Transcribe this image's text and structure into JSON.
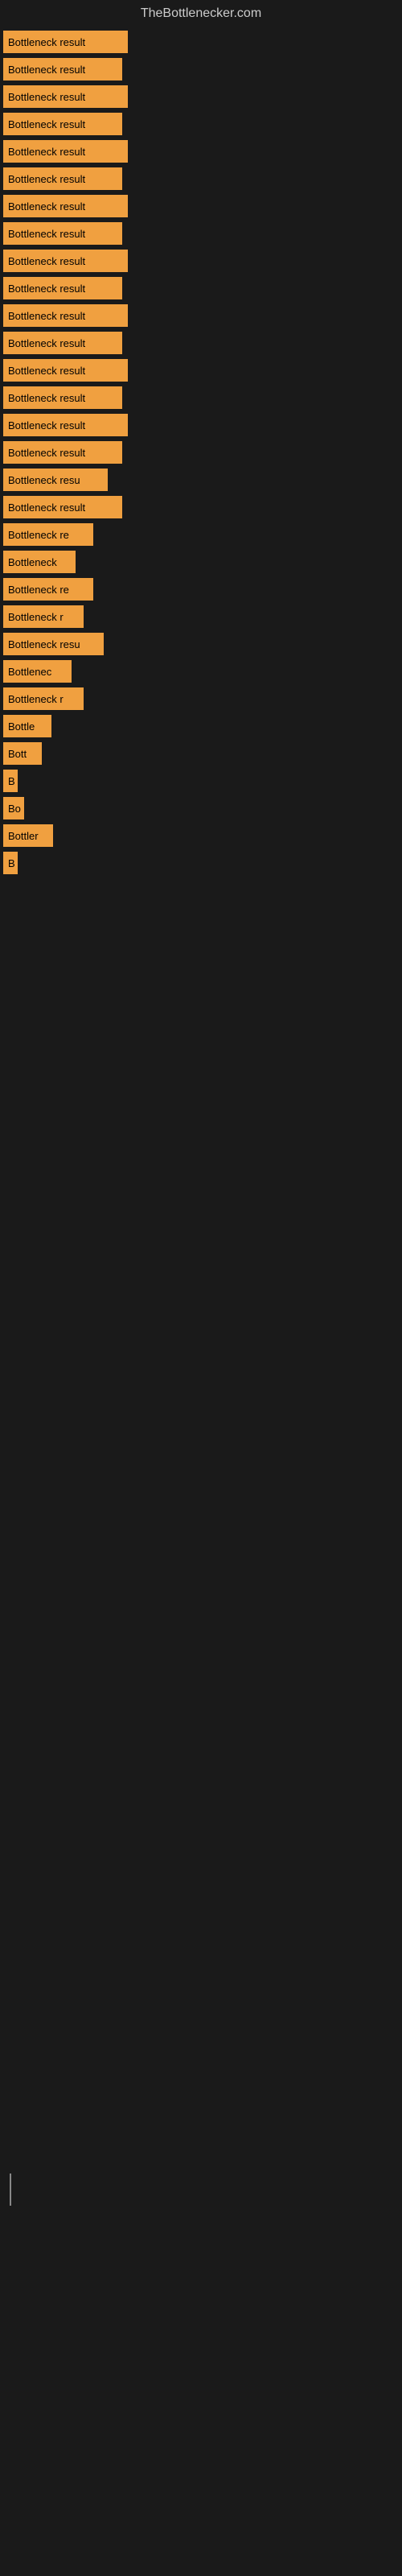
{
  "site": {
    "title": "TheBottlenecker.com"
  },
  "bars": [
    {
      "label": "Bottleneck result",
      "width": 155
    },
    {
      "label": "Bottleneck result",
      "width": 148
    },
    {
      "label": "Bottleneck result",
      "width": 155
    },
    {
      "label": "Bottleneck result",
      "width": 148
    },
    {
      "label": "Bottleneck result",
      "width": 155
    },
    {
      "label": "Bottleneck result",
      "width": 148
    },
    {
      "label": "Bottleneck result",
      "width": 155
    },
    {
      "label": "Bottleneck result",
      "width": 148
    },
    {
      "label": "Bottleneck result",
      "width": 155
    },
    {
      "label": "Bottleneck result",
      "width": 148
    },
    {
      "label": "Bottleneck result",
      "width": 155
    },
    {
      "label": "Bottleneck result",
      "width": 148
    },
    {
      "label": "Bottleneck result",
      "width": 155
    },
    {
      "label": "Bottleneck result",
      "width": 148
    },
    {
      "label": "Bottleneck result",
      "width": 155
    },
    {
      "label": "Bottleneck result",
      "width": 148
    },
    {
      "label": "Bottleneck resu",
      "width": 130
    },
    {
      "label": "Bottleneck result",
      "width": 148
    },
    {
      "label": "Bottleneck re",
      "width": 112
    },
    {
      "label": "Bottleneck",
      "width": 90
    },
    {
      "label": "Bottleneck re",
      "width": 112
    },
    {
      "label": "Bottleneck r",
      "width": 100
    },
    {
      "label": "Bottleneck resu",
      "width": 125
    },
    {
      "label": "Bottlenec",
      "width": 85
    },
    {
      "label": "Bottleneck r",
      "width": 100
    },
    {
      "label": "Bottle",
      "width": 60
    },
    {
      "label": "Bott",
      "width": 48
    },
    {
      "label": "B",
      "width": 18
    },
    {
      "label": "Bo",
      "width": 26
    },
    {
      "label": "Bottler",
      "width": 62
    },
    {
      "label": "B",
      "width": 18
    }
  ]
}
